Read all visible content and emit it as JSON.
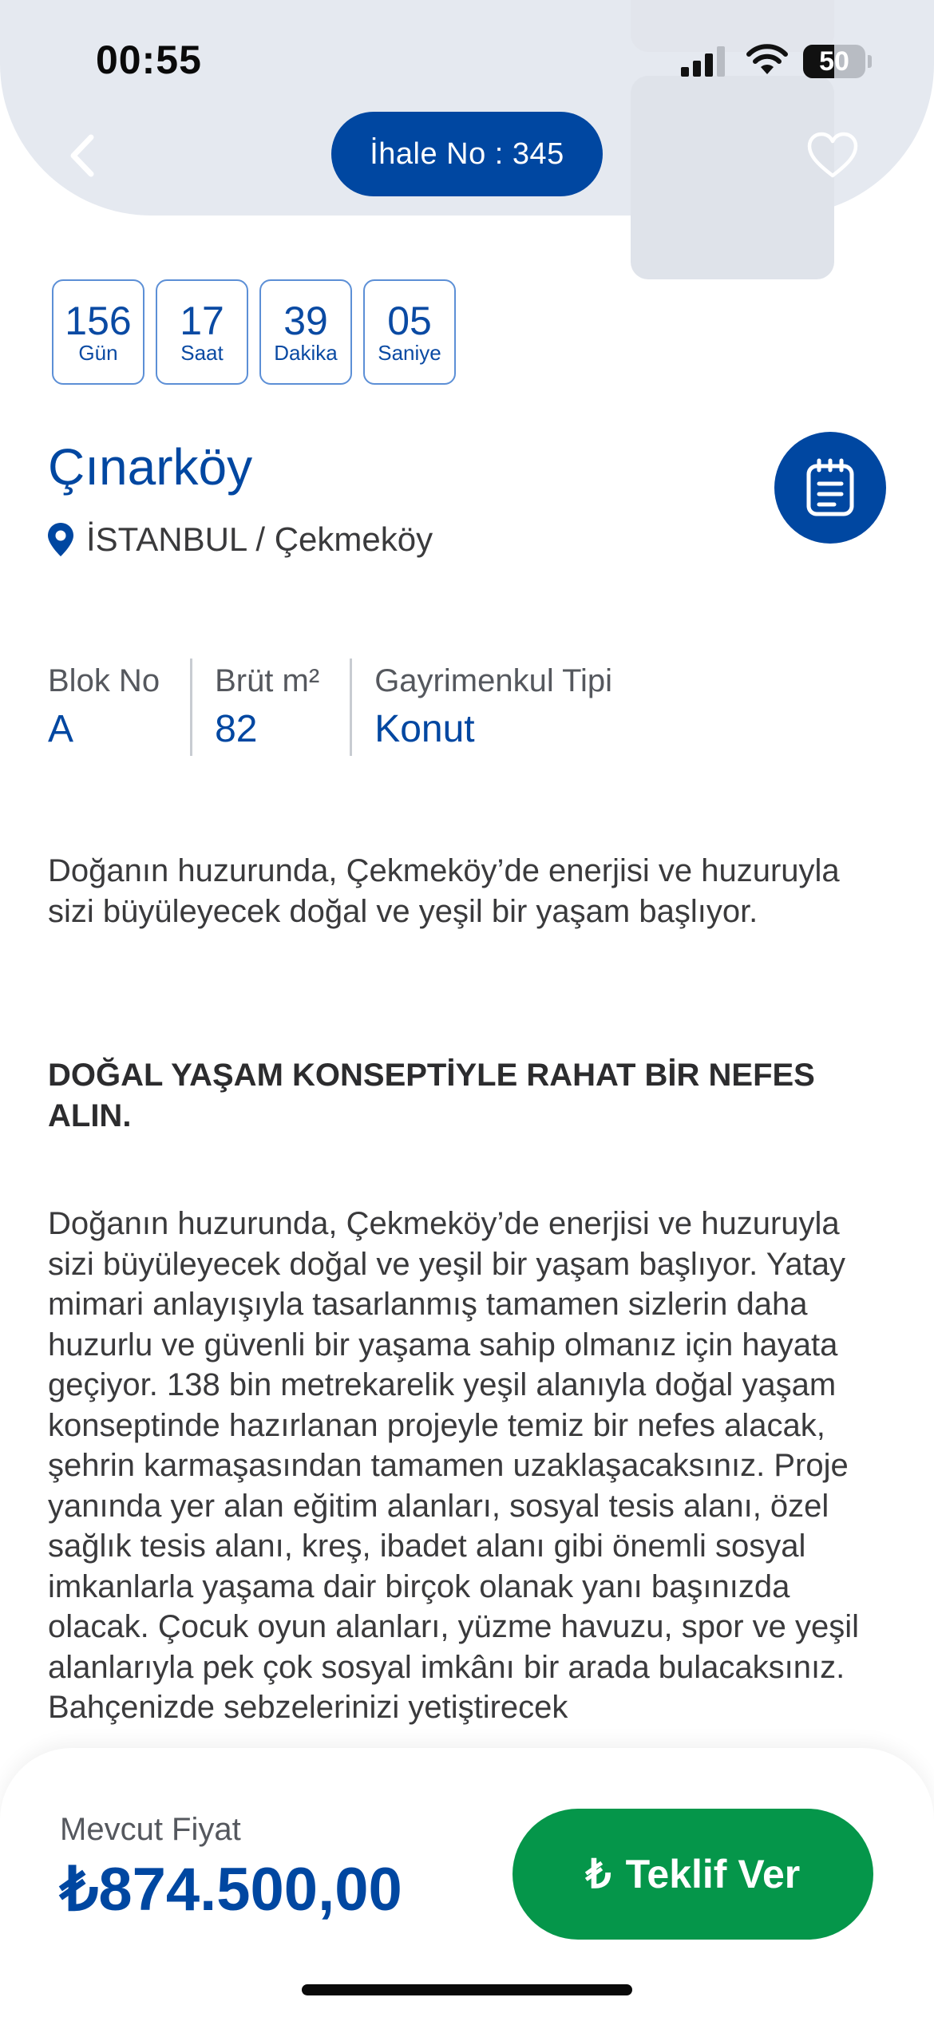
{
  "status_bar": {
    "time": "00:55",
    "battery_level": "50",
    "icons": [
      "signal-icon",
      "wifi-icon",
      "battery-icon"
    ]
  },
  "header": {
    "tender_label": "İhale No : 345",
    "back_icon": "chevron-left-icon",
    "favorite_icon": "heart-outline-icon"
  },
  "countdown": [
    {
      "value": "156",
      "unit": "Gün"
    },
    {
      "value": "17",
      "unit": "Saat"
    },
    {
      "value": "39",
      "unit": "Dakika"
    },
    {
      "value": "05",
      "unit": "Saniye"
    }
  ],
  "listing": {
    "title": "Çınarköy",
    "location": "İSTANBUL / Çekmeköy",
    "doc_icon": "document-icon"
  },
  "specs": [
    {
      "label": "Blok No",
      "value": "A"
    },
    {
      "label": "Brüt m²",
      "value": "82"
    },
    {
      "label": "Gayrimenkul Tipi",
      "value": "Konut"
    }
  ],
  "description": {
    "intro": "Doğanın huzurunda, Çekmeköy’de enerjisi ve huzuruyla sizi büyüleyecek doğal ve yeşil bir yaşam başlıyor.",
    "heading": "DOĞAL YAŞAM KONSEPTİYLE RAHAT BİR NEFES ALIN.",
    "body": "Doğanın huzurunda, Çekmeköy’de enerjisi ve huzuruyla sizi büyüleyecek doğal ve yeşil bir yaşam başlıyor. Yatay mimari anlayışıyla tasarlanmış tamamen sizlerin daha huzurlu ve güvenli bir yaşama sahip olmanız için hayata geçiyor. 138 bin metrekarelik yeşil alanıyla doğal yaşam konseptinde hazırlanan projeyle temiz bir nefes alacak, şehrin karmaşasından tamamen uzaklaşacaksınız. Proje yanında yer alan eğitim alanları, sosyal tesis alanı, özel sağlık tesis alanı, kreş, ibadet alanı gibi önemli sosyal imkanlarla yaşama dair birçok olanak yanı başınızda olacak. Çocuk oyun alanları, yüzme havuzu, spor ve yeşil alanlarıyla pek çok sosyal imkânı bir arada bulacaksınız. Bahçenizde sebzelerinizi yetiştirecek"
  },
  "footer": {
    "price_label": "Mevcut Fiyat",
    "price_value": "₺874.500,00",
    "offer_symbol": "₺",
    "offer_label": "Teklif Ver"
  },
  "colors": {
    "brand_blue": "#0047a1",
    "offer_green": "#05964a",
    "header_bg": "#e5e9f0"
  }
}
